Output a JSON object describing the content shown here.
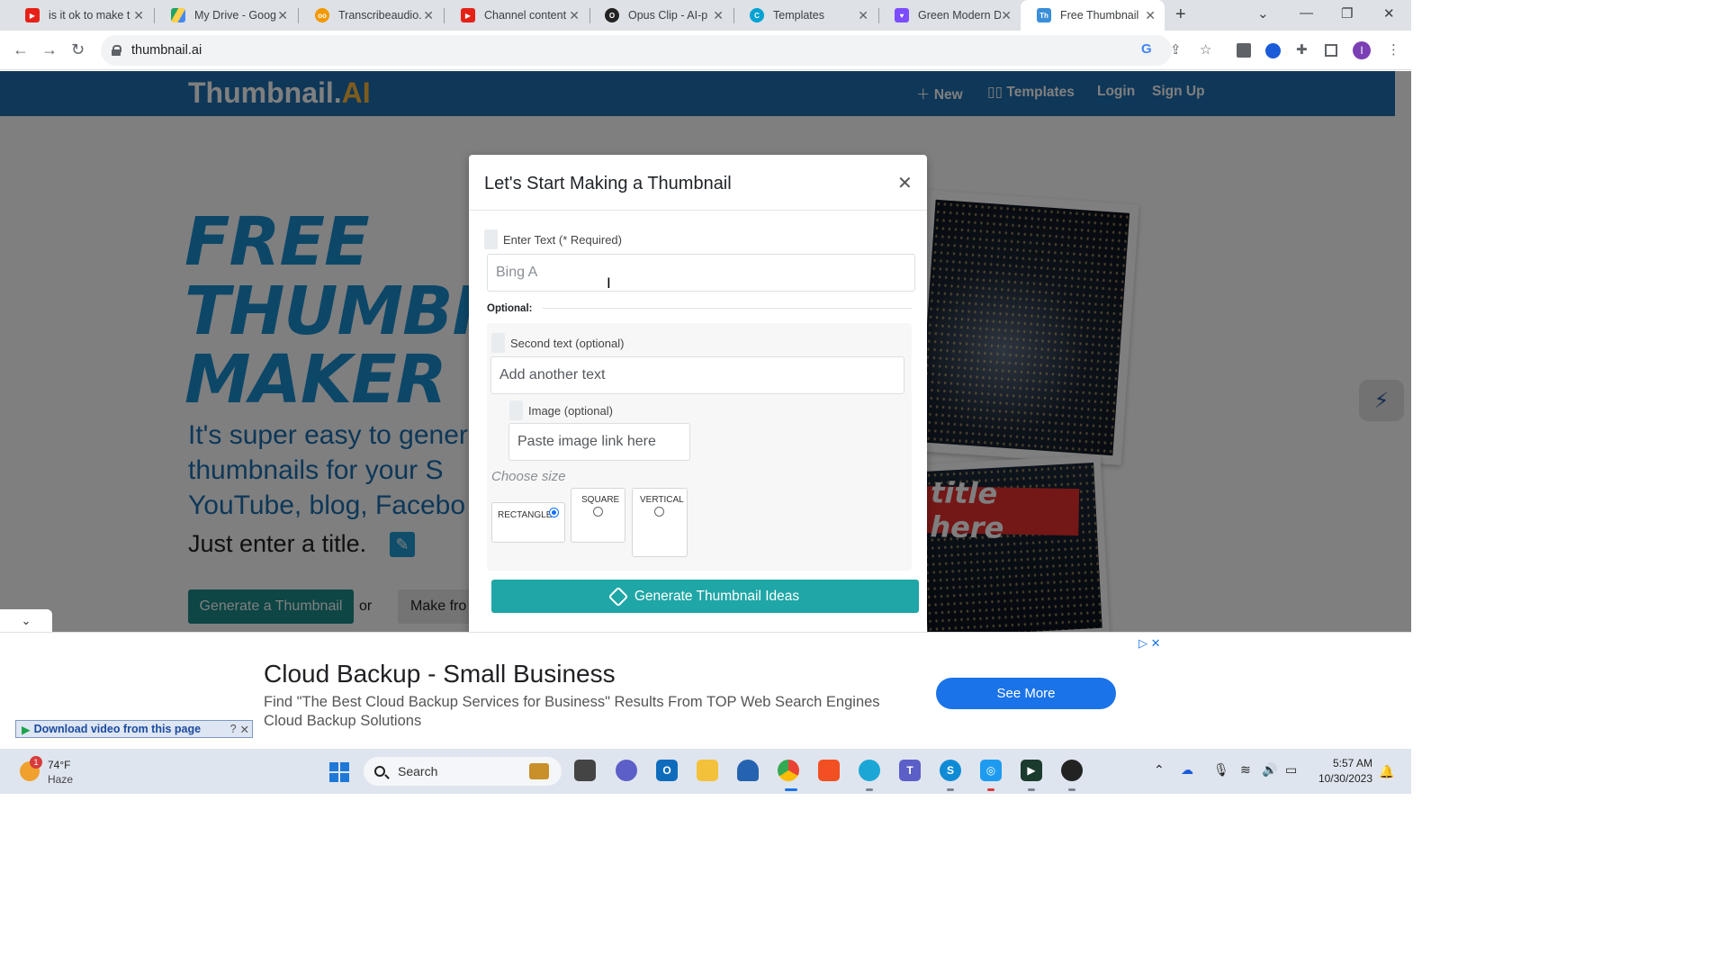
{
  "tabs": [
    {
      "title": "is it ok to make t",
      "color": "#e62117"
    },
    {
      "title": "My Drive - Goog",
      "color": "#1fa463"
    },
    {
      "title": "Transcribeaudio.",
      "color": "#f29900"
    },
    {
      "title": "Channel content",
      "color": "#e62117"
    },
    {
      "title": "Opus Clip - AI-p",
      "color": "#222222"
    },
    {
      "title": "Templates",
      "color": "#00a2d4"
    },
    {
      "title": "Green Modern D",
      "color": "#7c4dff"
    },
    {
      "title": "Free Thumbnail",
      "color": "#3b8ed8",
      "favicon_text": "Th"
    }
  ],
  "address": {
    "url": "thumbnail.ai"
  },
  "site": {
    "brand_main": "Thumbnail.",
    "brand_ai": "AI",
    "nav": {
      "new": "New",
      "templates": "Templates",
      "login": "Login",
      "signup": "Sign Up"
    },
    "hero_lines": [
      "FREE",
      "THUMBNAIL",
      "MAKER"
    ],
    "hero_sub": [
      "It's super easy to generate",
      "thumbnails for your S",
      "YouTube, blog, Facebo"
    ],
    "just_enter": "Just enter a title.",
    "generate_btn": "Generate a Thumbnail",
    "or": "or",
    "make_btn": "Make fro",
    "banner_text": "title here"
  },
  "modal": {
    "title": "Let's Start Making a Thumbnail",
    "enter_label": "Enter Text (* Required)",
    "enter_value": "Bing A",
    "optional": "Optional:",
    "second_label": "Second text (optional)",
    "second_placeholder": "Add another text",
    "image_label": "Image (optional)",
    "image_placeholder": "Paste image link here",
    "choose_size": "Choose size",
    "sizes": [
      {
        "label": "RECTANGLE",
        "selected": true
      },
      {
        "label": "SQUARE",
        "selected": false
      },
      {
        "label": "VERTICAL",
        "selected": false
      }
    ],
    "generate_ideas": "Generate Thumbnail Ideas"
  },
  "ad": {
    "title": "Cloud Backup - Small Business",
    "line1": "Find \"The Best Cloud Backup Services for Business\" Results From TOP Web Search Engines",
    "line2": "Cloud Backup Solutions",
    "button": "See More",
    "download_bar": "Download video from this page",
    "download_help": "?"
  },
  "taskbar": {
    "weather_badge": "1",
    "temp": "74°F",
    "condition": "Haze",
    "search": "Search",
    "time": "5:57 AM",
    "date": "10/30/2023"
  },
  "colors": {
    "accent": "#1fa6a6",
    "nav": "#1f6fb0",
    "ad_button": "#1a73e8"
  }
}
